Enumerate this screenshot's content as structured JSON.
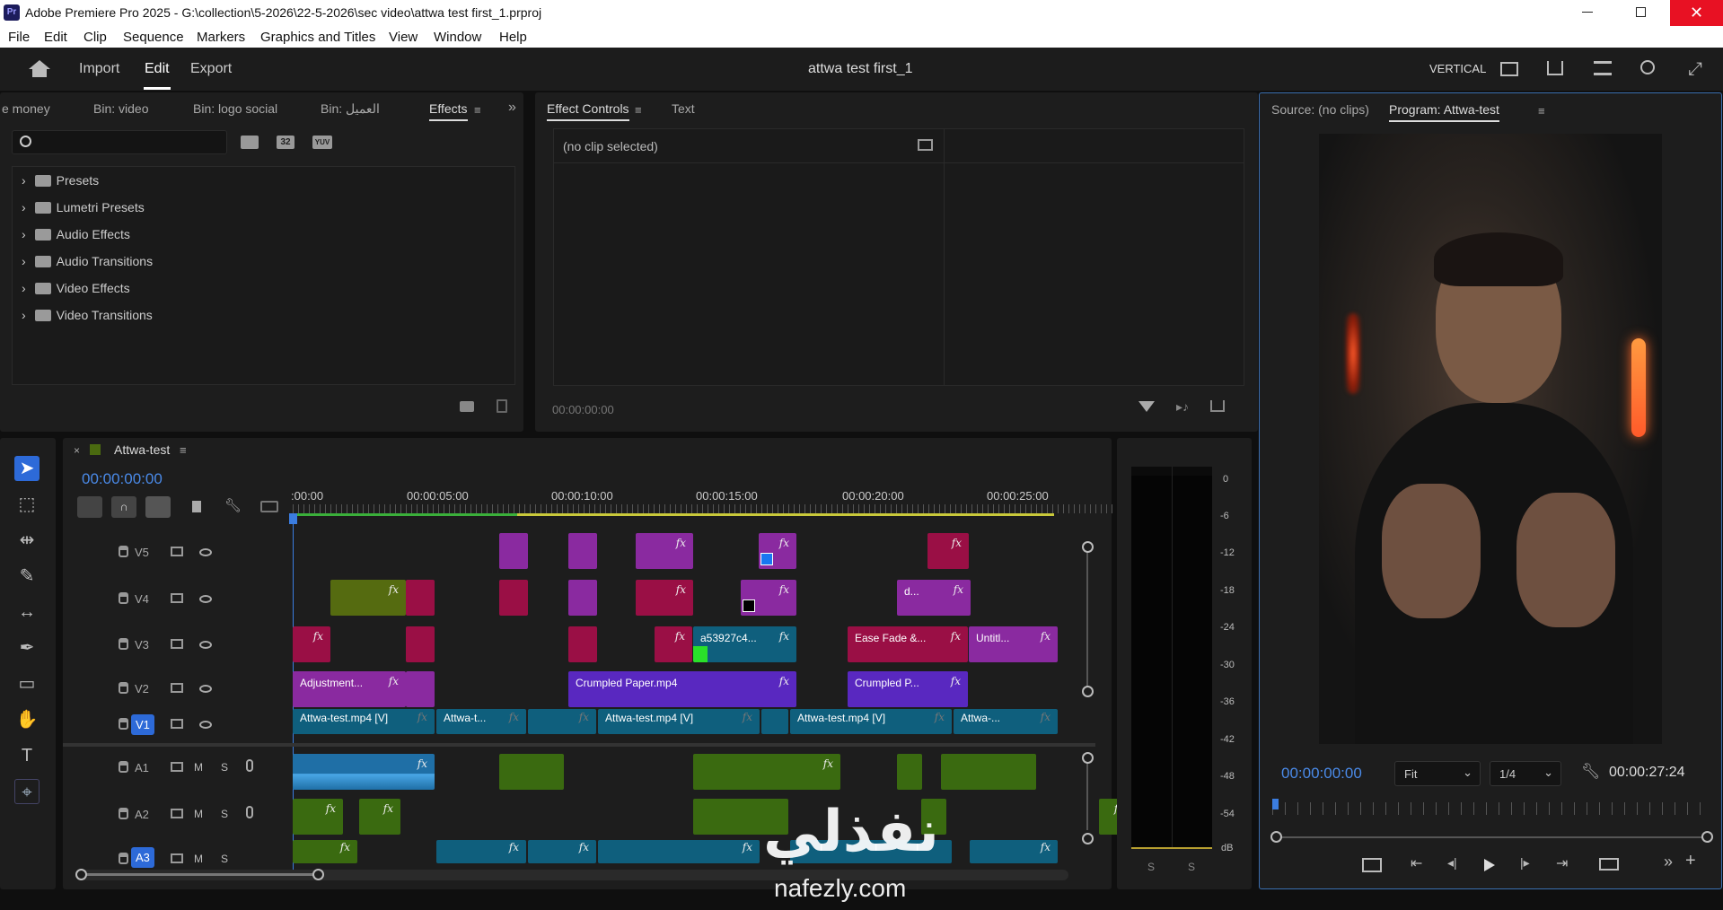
{
  "window": {
    "title": "Adobe Premiere Pro 2025 - G:\\collection\\5-2026\\22-5-2026\\sec video\\attwa test first_1.prproj",
    "app_icon": "Pr"
  },
  "menu": [
    "File",
    "Edit",
    "Clip",
    "Sequence",
    "Markers",
    "Graphics and Titles",
    "View",
    "Window",
    "Help"
  ],
  "header": {
    "nav": [
      "Import",
      "Edit",
      "Export"
    ],
    "active": "Edit",
    "project_title": "attwa test first_1",
    "workspace": "VERTICAL"
  },
  "effects_panel": {
    "tabs": [
      "e money",
      "Bin: video",
      "Bin: logo social",
      "Bin: العميل",
      "Effects"
    ],
    "active_tab": "Effects",
    "search_placeholder": "",
    "filter_badges": [
      "32",
      "YUV"
    ],
    "items": [
      "Presets",
      "Lumetri Presets",
      "Audio Effects",
      "Audio Transitions",
      "Video Effects",
      "Video Transitions"
    ]
  },
  "effect_controls": {
    "tabs": [
      "Effect Controls",
      "Text"
    ],
    "active_tab": "Effect Controls",
    "no_clip": "(no clip selected)",
    "timecode": "00:00:00:00"
  },
  "monitor": {
    "tabs": [
      "Source: (no clips)",
      "Program: Attwa-test"
    ],
    "active_tab": "Program: Attwa-test",
    "timecode": "00:00:00:00",
    "fit": "Fit",
    "resolution": "1/4",
    "duration": "00:00:27:24"
  },
  "timeline": {
    "sequence_name": "Attwa-test",
    "timecode": "00:00:00:00",
    "ruler": [
      ":00:00",
      "00:00:05:00",
      "00:00:10:00",
      "00:00:15:00",
      "00:00:20:00",
      "00:00:25:00"
    ],
    "video_tracks": [
      "V5",
      "V4",
      "V3",
      "V2",
      "V1"
    ],
    "audio_tracks": [
      "A1",
      "A2",
      "A3"
    ],
    "mute": "M",
    "solo": "S",
    "clips": {
      "v3_a": "a53927c4...",
      "v3_b": "Ease Fade &...",
      "v3_c": "Untitl...",
      "v4_a": "d...",
      "v2_a": "Adjustment...",
      "v2_b": "Crumpled Paper.mp4",
      "v2_c": "Crumpled P...",
      "v1_a": "Attwa-test.mp4 [V]",
      "v1_b": "Attwa-t...",
      "v1_c": "Attwa-test.mp4 [V]",
      "v1_d": "Attwa-test.mp4 [V]",
      "v1_e": "Attwa-..."
    },
    "fx": "fx"
  },
  "audio_meter": {
    "scale": [
      "0",
      "-6",
      "-12",
      "-18",
      "-24",
      "-30",
      "-36",
      "-42",
      "-48",
      "-54",
      "dB"
    ],
    "solo": [
      "S",
      "S"
    ]
  },
  "watermark": {
    "arabic": "نفذلي",
    "url": "nafezly.com"
  }
}
